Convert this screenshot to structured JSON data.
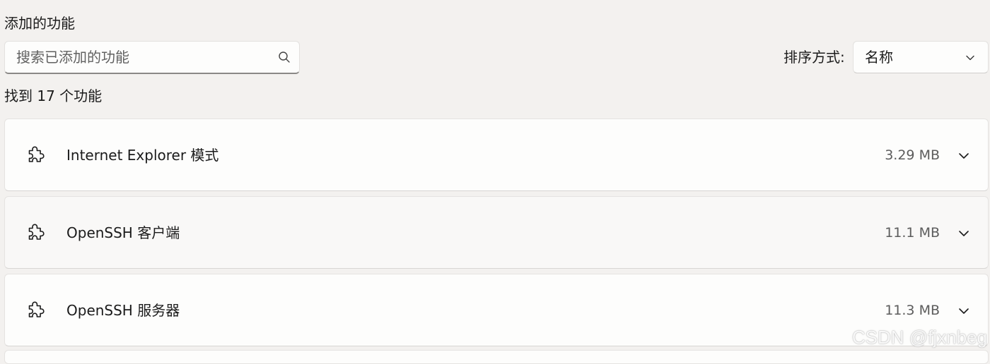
{
  "section_title": "添加的功能",
  "search": {
    "placeholder": "搜索已添加的功能",
    "value": "",
    "icon": "search-icon"
  },
  "sort": {
    "label": "排序方式:",
    "selected": "名称",
    "icon": "chevron-down-icon"
  },
  "result_count": "找到 17 个功能",
  "features": [
    {
      "name": "Internet Explorer 模式",
      "size": "3.29 MB",
      "icon": "puzzle-piece-icon"
    },
    {
      "name": "OpenSSH 客户端",
      "size": "11.1 MB",
      "icon": "puzzle-piece-icon"
    },
    {
      "name": "OpenSSH 服务器",
      "size": "11.3 MB",
      "icon": "puzzle-piece-icon"
    }
  ],
  "watermark": "CSDN @fjxnbeg"
}
